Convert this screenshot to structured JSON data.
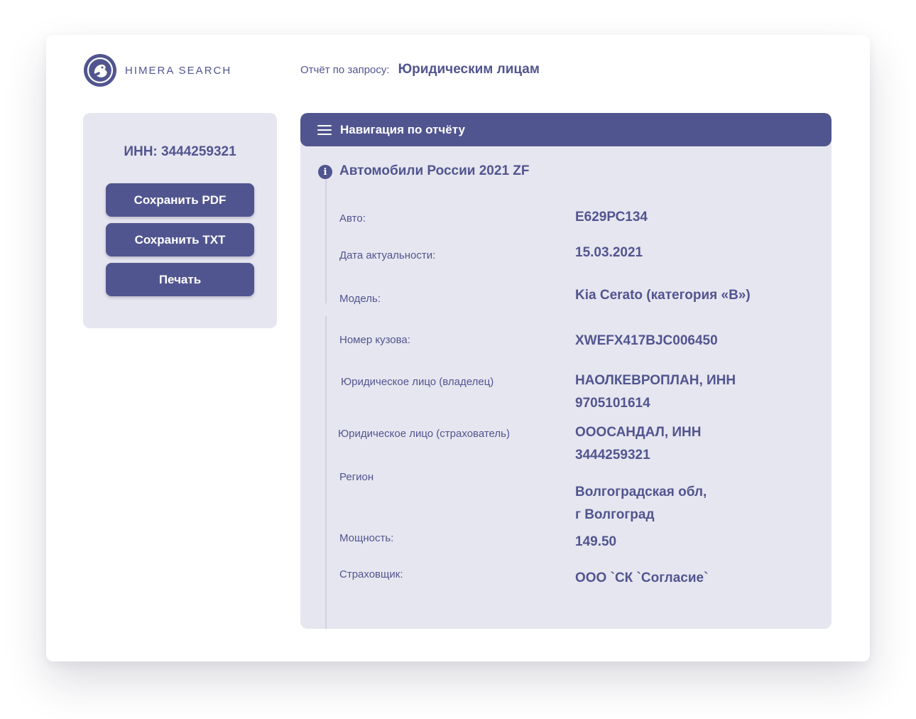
{
  "brand": {
    "name": "HIMERA SEARCH",
    "logo_icon": "himera-logo-icon"
  },
  "query": {
    "label": "Отчёт по запросу:",
    "value": "Юридическим лицам"
  },
  "sidebar": {
    "inn": "ИНН: 3444259321",
    "buttons": {
      "save_pdf": "Сохранить PDF",
      "save_txt": "Сохранить TXT",
      "print": "Печать"
    }
  },
  "report": {
    "nav_title": "Навигация по отчёту",
    "section_title": "Автомобили России 2021 ZF",
    "fields": [
      {
        "label": "Авто:",
        "value": "Е629РС134"
      },
      {
        "label": "Дата актуальности:",
        "value": "15.03.2021"
      },
      {
        "label": "Модель:",
        "value": "Kia Cerato (категория «В»)"
      },
      {
        "label": "Номер кузова:",
        "value": "XWEFX417BJC006450"
      },
      {
        "label": "Юридическое лицо (владелец)",
        "value_line1": "НАОЛКЕВРОПЛАН, ИНН",
        "value_line2": "9705101614"
      },
      {
        "label": "Юридическое лицо (страхователь)",
        "value_line1": "ОООСАНДАЛ, ИНН",
        "value_line2": "3444259321"
      },
      {
        "label": "Регион",
        "value_line1": "Волгоградская обл,",
        "value_line2": "г Волгоград"
      },
      {
        "label": "Мощность:",
        "value": "149.50"
      },
      {
        "label": "Страховщик:",
        "value": "ООО `СК `Согласие`"
      }
    ]
  },
  "colors": {
    "accent": "#51558f",
    "panel": "#e6e6f0",
    "background": "#ffffff"
  }
}
